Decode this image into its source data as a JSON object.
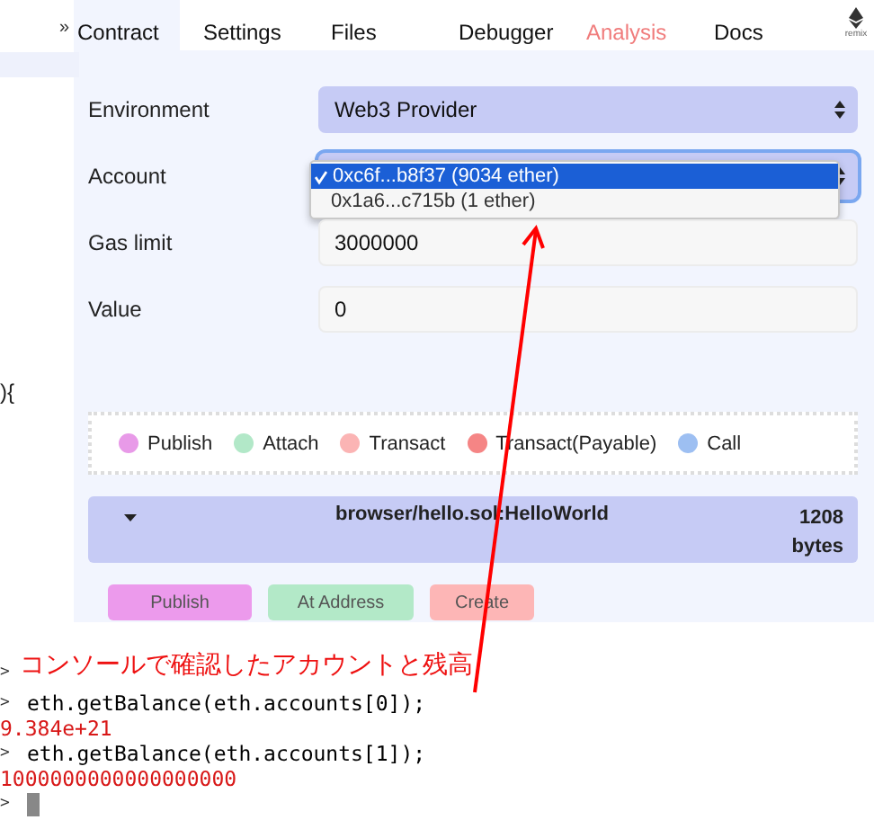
{
  "sidebar": {
    "toggle": "»",
    "code_fragment": "){"
  },
  "tabs": [
    {
      "label": "Contract",
      "selected": true,
      "alert": false
    },
    {
      "label": "Settings",
      "selected": false,
      "alert": false
    },
    {
      "label": "Files",
      "selected": false,
      "alert": false
    },
    {
      "label": "Debugger",
      "selected": false,
      "alert": false
    },
    {
      "label": "Analysis",
      "selected": false,
      "alert": true
    },
    {
      "label": "Docs",
      "selected": false,
      "alert": false
    }
  ],
  "logo": {
    "text": "remix"
  },
  "form": [
    {
      "label": "Environment",
      "kind": "select",
      "value": "Web3 Provider"
    },
    {
      "label": "Account",
      "kind": "select",
      "open": true,
      "options": [
        {
          "text": "0xc6f...b8f37 (9034 ether)",
          "selected": true
        },
        {
          "text": "0x1a6...c715b (1 ether)",
          "selected": false
        }
      ]
    },
    {
      "label": "Gas limit",
      "kind": "input",
      "value": "3000000"
    },
    {
      "label": "Value",
      "kind": "input",
      "value": "0"
    }
  ],
  "legend": [
    {
      "label": "Publish",
      "color": "#e89ae8"
    },
    {
      "label": "Attach",
      "color": "#b2e8c8"
    },
    {
      "label": "Transact",
      "color": "#fbb4b4"
    },
    {
      "label": "Transact(Payable)",
      "color": "#f58585"
    },
    {
      "label": "Call",
      "color": "#9dbff2"
    }
  ],
  "contract": {
    "name": "browser/hello.sol:HelloWorld",
    "size": "1208 bytes"
  },
  "buttons": [
    {
      "label": "Publish",
      "color": "#ec9aec"
    },
    {
      "label": "At Address",
      "color": "#b3e9c8"
    },
    {
      "label": "Create",
      "color": "#fdb6b6"
    }
  ],
  "annotation": "コンソールで確認したアカウントと残高",
  "console": {
    "prompt": ">",
    "lines": [
      {
        "kind": "input",
        "text": "eth.getBalance(eth.accounts[0]);"
      },
      {
        "kind": "output",
        "text": "9.384e+21"
      },
      {
        "kind": "input",
        "text": "eth.getBalance(eth.accounts[1]);"
      },
      {
        "kind": "output",
        "text": "1000000000000000000"
      }
    ]
  }
}
